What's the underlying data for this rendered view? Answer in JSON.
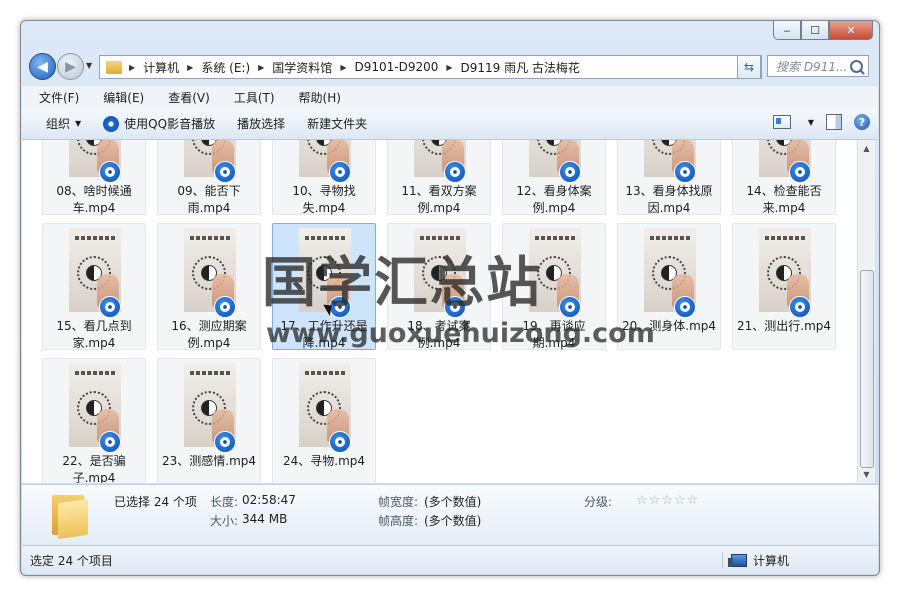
{
  "window": {
    "minimize": "‒",
    "maximize": "☐",
    "close": "✕"
  },
  "address": {
    "crumbs": [
      "计算机",
      "系统 (E:)",
      "国学资料馆",
      "D9101-D9200",
      "D9119 雨凡 古法梅花"
    ],
    "search_placeholder": "搜索 D911..."
  },
  "menu": [
    "文件(F)",
    "编辑(E)",
    "查看(V)",
    "工具(T)",
    "帮助(H)"
  ],
  "toolbar": {
    "organize": "组织",
    "play_qq": "使用QQ影音播放",
    "play_selection": "播放选择",
    "new_folder": "新建文件夹"
  },
  "files": [
    {
      "label": "08、啥时候通车.mp4"
    },
    {
      "label": "09、能否下雨.mp4"
    },
    {
      "label": "10、寻物找失.mp4"
    },
    {
      "label": "11、看双方案例.mp4"
    },
    {
      "label": "12、看身体案例.mp4"
    },
    {
      "label": "13、看身体找原因.mp4"
    },
    {
      "label": "14、检查能否来.mp4"
    },
    {
      "label": "15、看几点到家.mp4"
    },
    {
      "label": "16、测应期案例.mp4"
    },
    {
      "label": "17、工作升还是降.mp4"
    },
    {
      "label": "18、考试案例.mp4"
    },
    {
      "label": "19、再谈应期.mp4"
    },
    {
      "label": "20、测身体.mp4"
    },
    {
      "label": "21、测出行.mp4"
    },
    {
      "label": "22、是否骗子.mp4"
    },
    {
      "label": "23、测感情.mp4"
    },
    {
      "label": "24、寻物.mp4"
    }
  ],
  "selected_index": 9,
  "details": {
    "selected_count": "已选择 24 个项",
    "length_label": "长度:",
    "length_value": "02:58:47",
    "size_label": "大小:",
    "size_value": "344 MB",
    "frame_width_label": "帧宽度:",
    "frame_width_value": "(多个数值)",
    "frame_height_label": "帧高度:",
    "frame_height_value": "(多个数值)",
    "rating_label": "分级:",
    "rating_stars": 0
  },
  "status": {
    "left": "选定 24 个项目",
    "right": "计算机"
  },
  "watermark": {
    "title": "国学汇总站",
    "url": "www.guoxuehuizong.com"
  },
  "colors": {
    "selection": "#cde4fa",
    "accent": "#1d5fb8"
  }
}
